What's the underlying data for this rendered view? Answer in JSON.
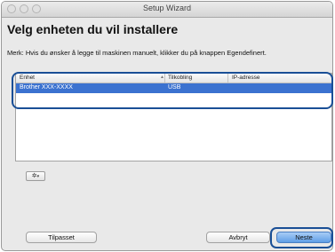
{
  "window": {
    "title": "Setup Wizard"
  },
  "page": {
    "heading": "Velg enheten du vil installere",
    "note": "Merk: Hvis du ønsker å legge til maskinen manuelt, klikker du på knappen Egendefinert."
  },
  "device_list": {
    "columns": [
      "Enhet",
      "Tilkobling",
      "IP-adresse"
    ],
    "rows": [
      {
        "device": "Brother XXX-XXXX",
        "connection": "USB",
        "ip": "",
        "selected": true
      }
    ]
  },
  "icons": {
    "gear_menu": "gear-icon",
    "dropdown": "chevron-down-icon"
  },
  "buttons": {
    "custom": "Tilpasset",
    "cancel": "Avbryt",
    "next": "Neste"
  },
  "colors": {
    "selection": "#3b72d0",
    "callout_outline": "#1a4f96",
    "default_button": "#5f9ee6"
  }
}
